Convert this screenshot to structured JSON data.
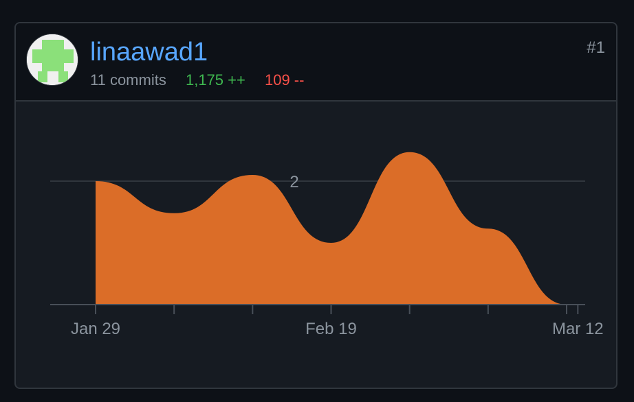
{
  "contributor": {
    "username": "linaawad1",
    "commits": "11 commits",
    "additions": "1,175 ++",
    "deletions": "109 --",
    "rank": "#1",
    "avatar_icon": "identicon-avatar-icon",
    "avatar_color": "#8be07a"
  },
  "chart_data": {
    "type": "area",
    "x": [
      "2024-01-29",
      "2024-02-05",
      "2024-02-12",
      "2024-02-19",
      "2024-02-26",
      "2024-03-04",
      "2024-03-11"
    ],
    "series": [
      {
        "values": [
          2.0,
          1.48,
          2.1,
          1.0,
          2.47,
          1.23,
          0
        ]
      }
    ],
    "y_tick_labels": [
      "2"
    ],
    "y_ticks": [
      2
    ],
    "ylim": [
      0,
      2.6
    ],
    "x_tick_labels": [
      "Jan 29",
      "Feb 19",
      "Mar 12"
    ],
    "x_tick_positions": [
      "2024-01-29",
      "2024-02-19",
      "2024-03-12"
    ],
    "grid": true,
    "color": "#db6d28"
  }
}
